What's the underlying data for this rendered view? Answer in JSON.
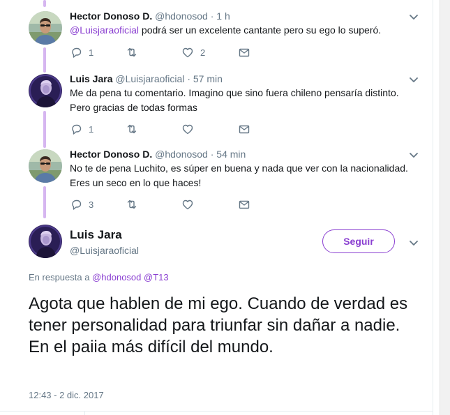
{
  "thread": [
    {
      "name": "Hector Donoso D.",
      "handle": "@hdonosod",
      "separator": "·",
      "time": "1 h",
      "mention": "@Luisjaraoficial",
      "text_after_mention": " podrá ser un excelente cantante pero su ego lo superó.",
      "text_lines": [],
      "reply_count": "1",
      "retweet_count": "",
      "like_count": "2"
    },
    {
      "name": "Luis Jara",
      "handle": "@Luisjaraoficial",
      "separator": "·",
      "time": "57 min",
      "mention": "",
      "text_after_mention": "",
      "text_lines": [
        "Me da pena tu comentario.  Imagino que sino fuera chileno pensaría distinto.",
        "Pero gracias de todas formas"
      ],
      "reply_count": "1",
      "retweet_count": "",
      "like_count": ""
    },
    {
      "name": "Hector Donoso D.",
      "handle": "@hdonosod",
      "separator": "·",
      "time": "54 min",
      "mention": "",
      "text_after_mention": "",
      "text_lines": [
        "No te de pena Luchito, es súper en buena y nada que ver con la nacionalidad.",
        "Eres un seco en lo que haces!"
      ],
      "reply_count": "3",
      "retweet_count": "",
      "like_count": ""
    }
  ],
  "main_tweet": {
    "name": "Luis Jara",
    "handle": "@Luisjaraoficial",
    "follow_label": "Seguir",
    "reply_prefix": "En respuesta a",
    "reply_mention_1": "@hdonosod",
    "reply_mention_2": "@T13",
    "text": "Agota que hablen de mi ego.  Cuando de verdad es tener personalidad para triunfar sin dañar a nadie.  En el paiia más difícil del mundo.",
    "timestamp": "12:43 - 2 dic. 2017"
  },
  "icons": {
    "reply": "reply-icon",
    "retweet": "retweet-icon",
    "like": "heart-icon",
    "message": "envelope-icon",
    "more": "chevron-down-icon"
  },
  "colors": {
    "accent": "#8a3fd1",
    "thread_line": "#d6b6f0",
    "secondary_text": "#657786"
  }
}
